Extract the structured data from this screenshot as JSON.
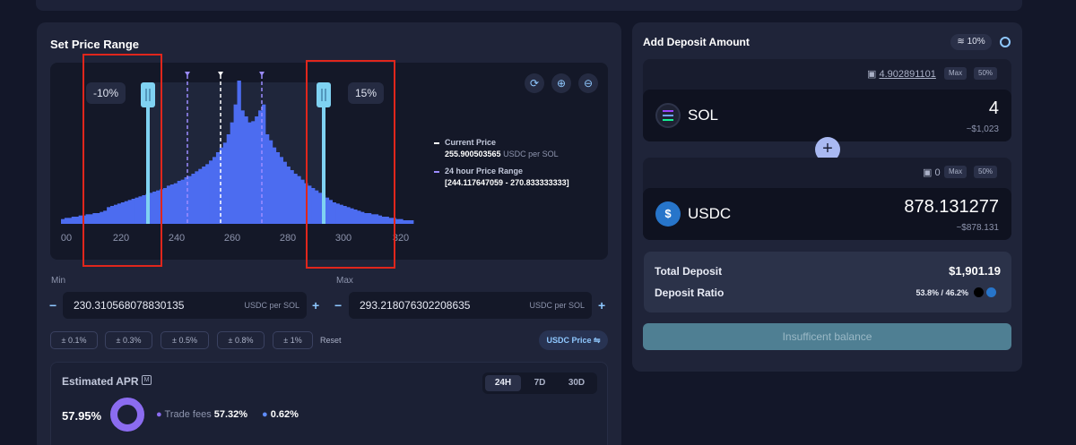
{
  "range": {
    "title": "Set Price Range",
    "lower_pct": "-10%",
    "upper_pct": "15%",
    "ticks": [
      "00",
      "220",
      "240",
      "260",
      "280",
      "300",
      "320"
    ],
    "legend": {
      "current_price_label": "Current Price",
      "current_price_value": "255.900503565",
      "current_price_unit": "USDC per SOL",
      "range_label": "24 hour Price Range",
      "range_value": "[244.117647059 - 270.833333333]"
    },
    "min_label": "Min",
    "max_label": "Max",
    "min_value": "230.310568078830135",
    "max_value": "293.218076302208635",
    "unit": "USDC per SOL",
    "presets": [
      "± 0.1%",
      "± 0.3%",
      "± 0.5%",
      "± 0.8%",
      "± 1%"
    ],
    "reset_label": "Reset",
    "usdc_price_label": "USDC Price ⇋"
  },
  "apr": {
    "title": "Estimated APR",
    "badge": "M",
    "periods": [
      "24H",
      "7D",
      "30D"
    ],
    "active_period": "24H",
    "value": "57.95%",
    "trade_fees_label": "Trade fees",
    "trade_fees_value": "57.32%",
    "rewards_value": "0.62%",
    "colors": {
      "trade_fees": "#8b6cf0",
      "rewards": "#5f8cff"
    }
  },
  "deposit": {
    "title": "Add Deposit Amount",
    "slippage": "10%",
    "sol": {
      "balance": "4.902891101",
      "max_label": "Max",
      "half_label": "50%",
      "symbol": "SOL",
      "amount": "4",
      "usd": "~$1,023"
    },
    "usdc": {
      "balance": "0",
      "max_label": "Max",
      "half_label": "50%",
      "symbol": "USDC",
      "amount": "878.131277",
      "usd": "~$878.131"
    },
    "total_label": "Total Deposit",
    "total_value": "$1,901.19",
    "ratio_label": "Deposit Ratio",
    "ratio_value": "53.8% / 46.2%",
    "button_label": "Insufficent balance"
  },
  "histogram": [
    4,
    5,
    5,
    6,
    6,
    7,
    7,
    8,
    8,
    9,
    9,
    10,
    11,
    14,
    15,
    16,
    17,
    18,
    19,
    20,
    21,
    22,
    23,
    24,
    25,
    26,
    27,
    28,
    29,
    30,
    32,
    33,
    34,
    36,
    37,
    39,
    40,
    42,
    44,
    46,
    48,
    50,
    53,
    56,
    60,
    64,
    68,
    75,
    85,
    100,
    120,
    95,
    90,
    85,
    86,
    90,
    95,
    100,
    75,
    70,
    64,
    60,
    56,
    52,
    48,
    45,
    42,
    40,
    37,
    34,
    32,
    30,
    28,
    26,
    24,
    22,
    20,
    18,
    17,
    16,
    15,
    14,
    13,
    12,
    11,
    10,
    9,
    9,
    8,
    8,
    7,
    6,
    6,
    5,
    5,
    4,
    4,
    3,
    3,
    3
  ]
}
